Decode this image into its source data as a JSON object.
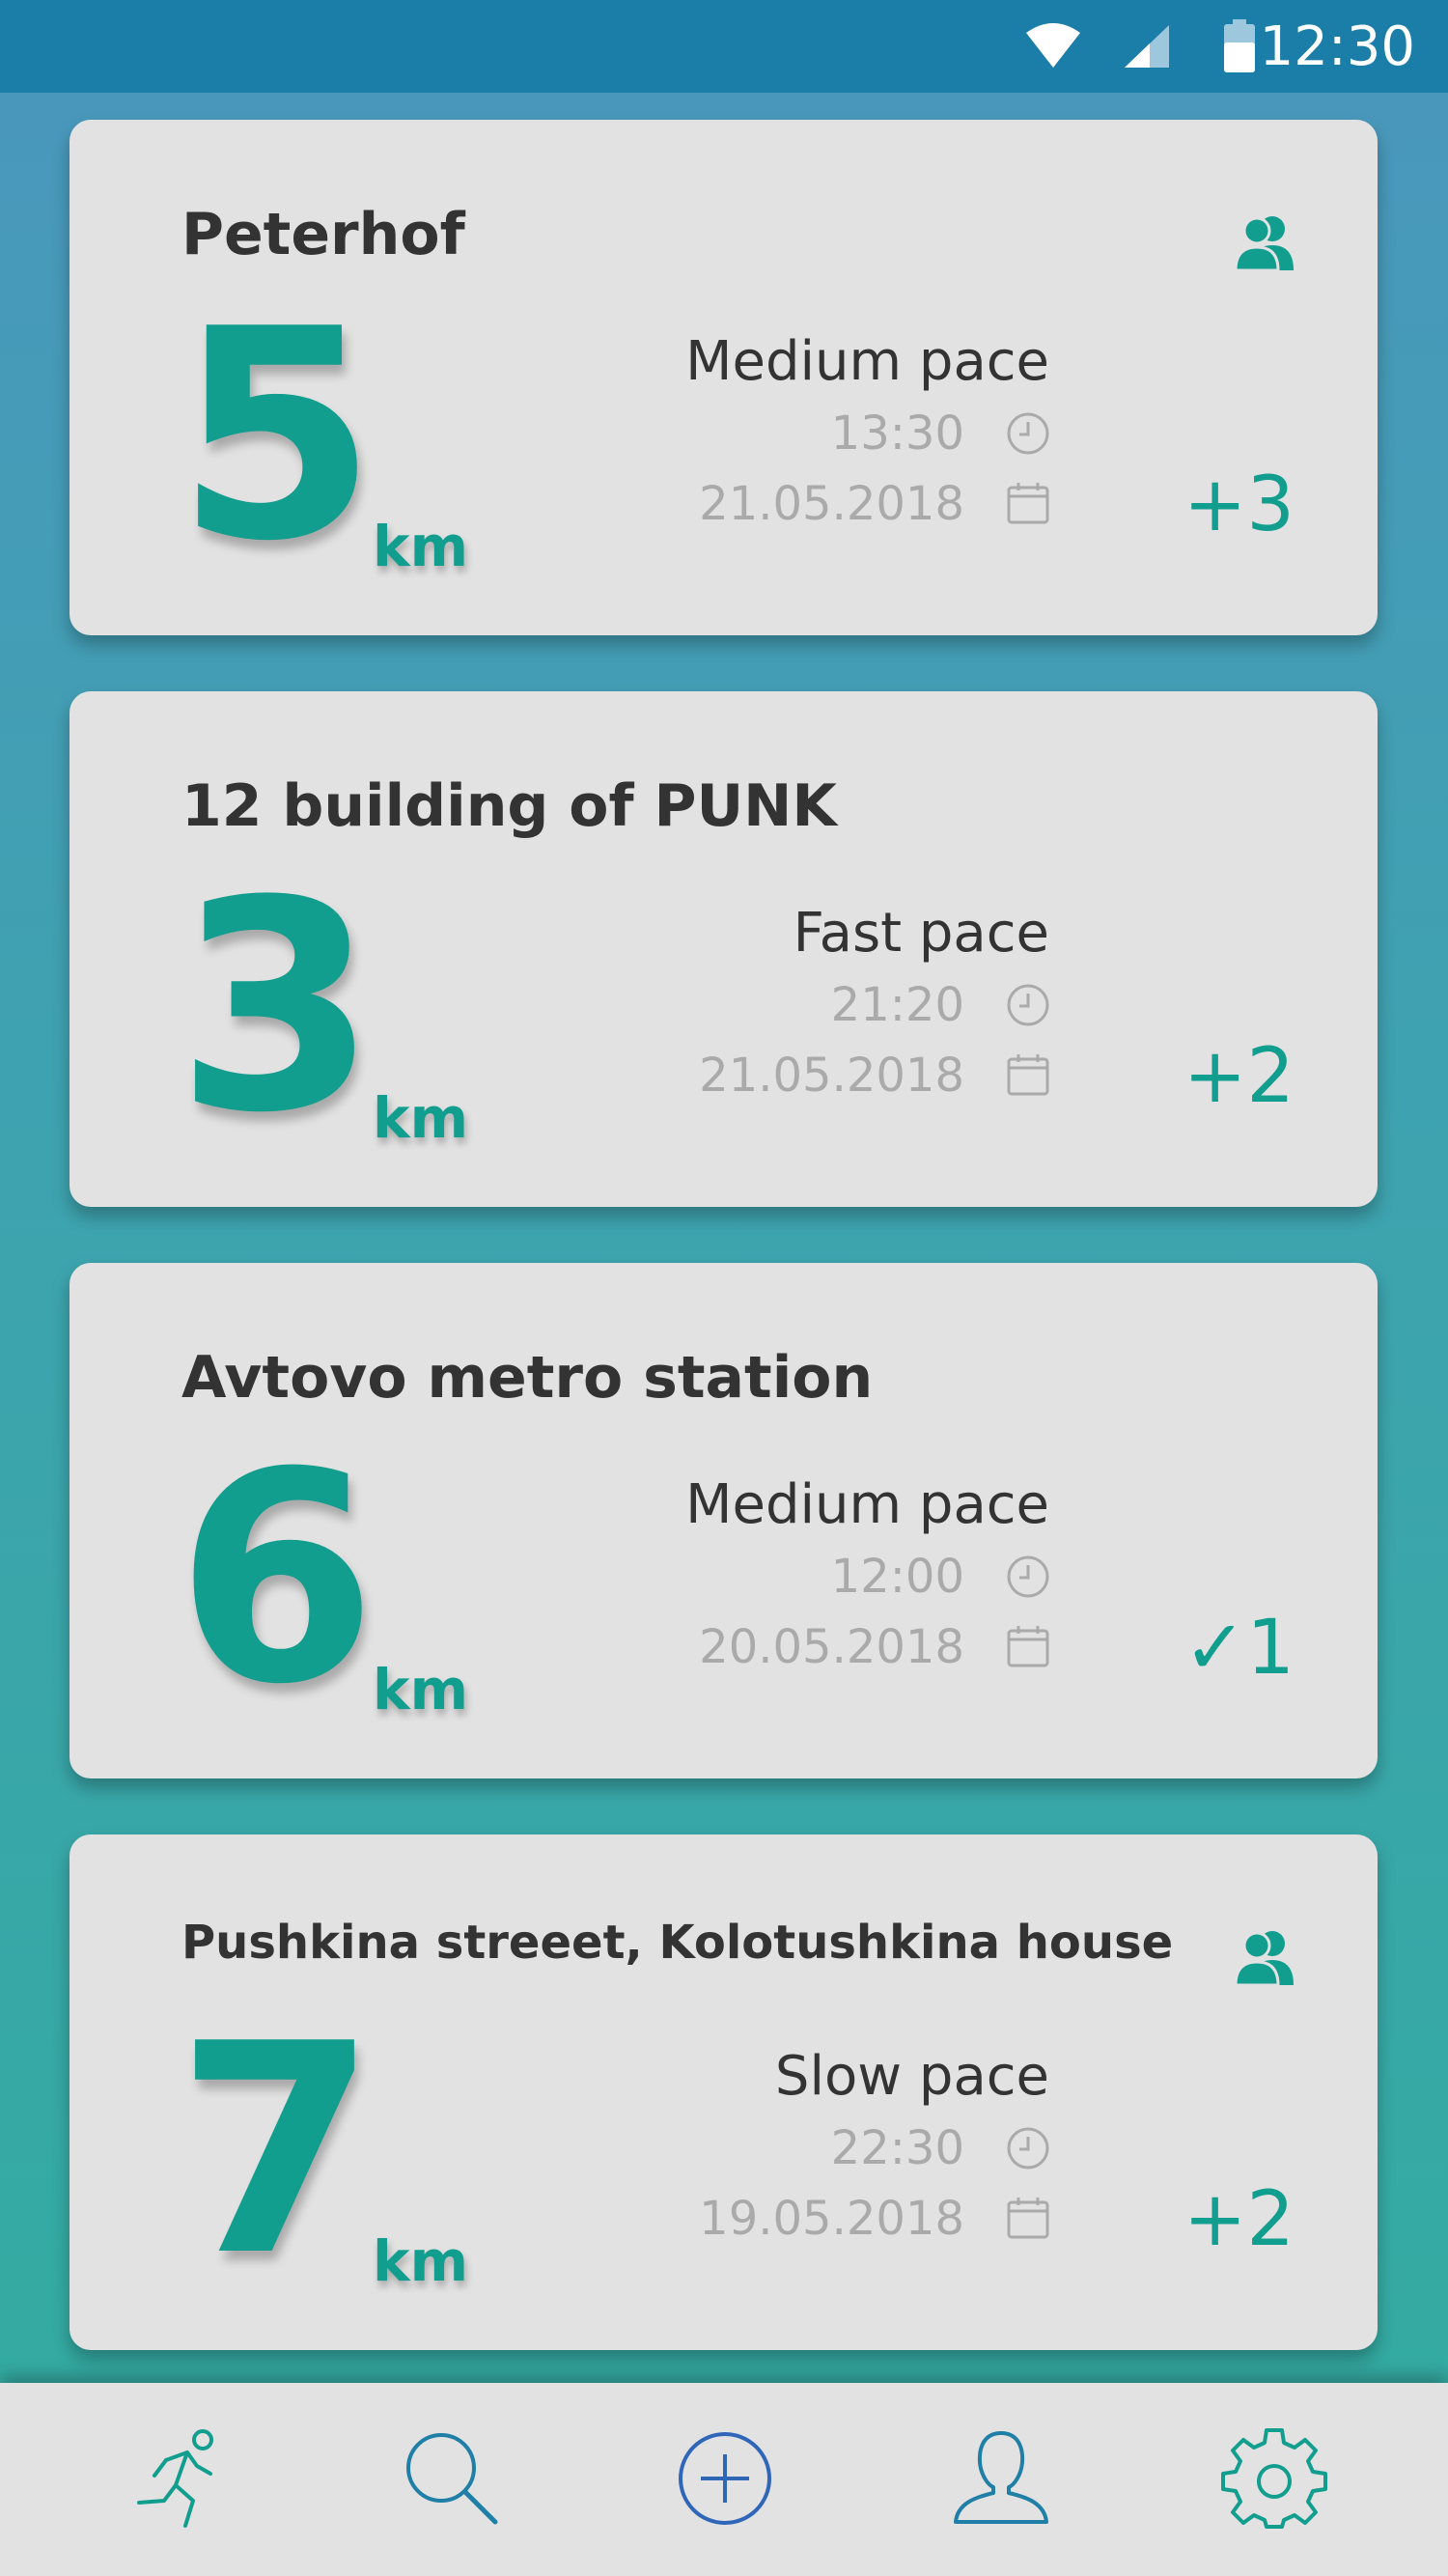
{
  "status_bar": {
    "time": "12:30",
    "icons": [
      "wifi-icon",
      "signal-icon",
      "battery-icon"
    ]
  },
  "runs": [
    {
      "title": "Peterhof",
      "distance": "5",
      "unit": "km",
      "pace": "Medium pace",
      "time": "13:30",
      "date": "21.05.2018",
      "count_symbol": "+",
      "count": "3",
      "group_icon": true
    },
    {
      "title": "12 building of PUNK",
      "distance": "3",
      "unit": "km",
      "pace": "Fast pace",
      "time": "21:20",
      "date": "21.05.2018",
      "count_symbol": "+",
      "count": "2",
      "group_icon": false
    },
    {
      "title": "Avtovo metro station",
      "distance": "6",
      "unit": "km",
      "pace": "Medium pace",
      "time": "12:00",
      "date": "20.05.2018",
      "count_symbol": "✓",
      "count": "1",
      "group_icon": false
    },
    {
      "title": "Pushkina streeet, Kolotushkina house",
      "distance": "7",
      "unit": "km",
      "pace": "Slow pace",
      "time": "22:30",
      "date": "19.05.2018",
      "count_symbol": "+",
      "count": "2",
      "group_icon": true
    }
  ],
  "bottom_nav": {
    "items": [
      "runner-icon",
      "search-icon",
      "add-icon",
      "profile-icon",
      "settings-icon"
    ]
  },
  "colors": {
    "accent": "#129e8e",
    "status_bar": "#1a7ea8",
    "card": "#e2e2e2",
    "nav_blue": "#2f66b8"
  }
}
